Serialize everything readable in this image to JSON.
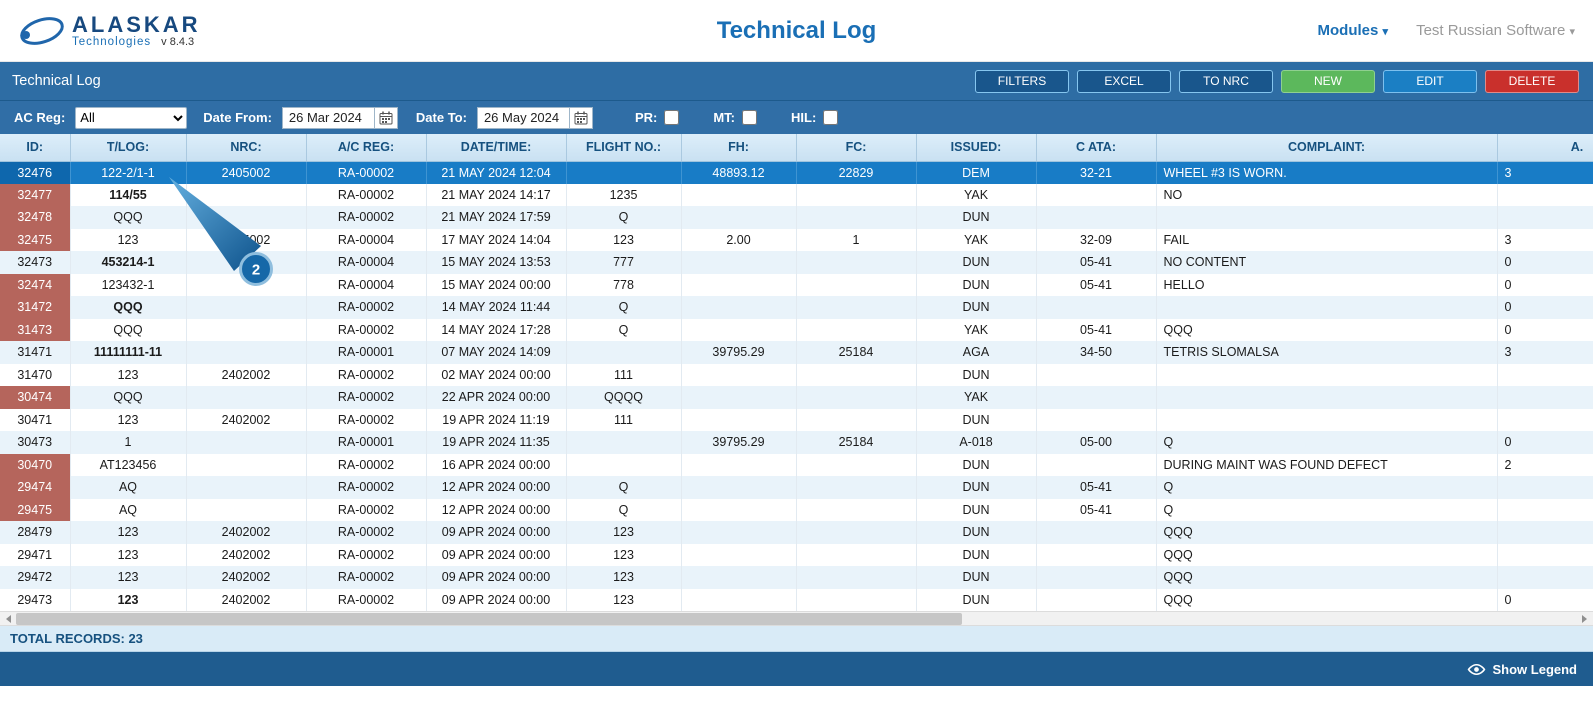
{
  "app": {
    "logo_brand": "ALASKAR",
    "logo_sub": "Technologies",
    "version": "v 8.4.3",
    "page_title": "Technical Log",
    "nav": {
      "modules": "Modules",
      "user": "Test Russian Software",
      "caret": "▾"
    }
  },
  "panel": {
    "title": "Technical Log",
    "buttons": {
      "filters": "FILTERS",
      "excel": "EXCEL",
      "to_nrc": "TO NRC",
      "new": "NEW",
      "edit": "EDIT",
      "delete": "DELETE"
    }
  },
  "filters": {
    "ac_reg_label": "AC Reg:",
    "ac_reg_value": "All",
    "date_from_label": "Date From:",
    "date_from_value": "26 Mar 2024",
    "date_to_label": "Date To:",
    "date_to_value": "26 May 2024",
    "pr_label": "PR:",
    "pr_checked": false,
    "mt_label": "MT:",
    "mt_checked": false,
    "hil_label": "HIL:",
    "hil_checked": false
  },
  "table": {
    "columns": [
      "ID:",
      "T/LOG:",
      "NRC:",
      "A/C REG:",
      "DATE/TIME:",
      "FLIGHT NO.:",
      "FH:",
      "FC:",
      "ISSUED:",
      "C ATA:",
      "COMPLAINT:",
      "A."
    ],
    "rows": [
      {
        "id": "32476",
        "selected": true,
        "tlog": "122-2/1-1",
        "nrc": "2405002",
        "acreg": "RA-00002",
        "datetime": "21 MAY 2024 12:04",
        "fh": "48893.12",
        "fc": "22829",
        "issued": "DEM",
        "cata": "32-21",
        "complaint": "WHEEL #3 IS WORN.",
        "a": "3"
      },
      {
        "id": "32477",
        "id_red": true,
        "tlog": "114/55",
        "tlog_bold": true,
        "acreg": "RA-00002",
        "datetime": "21 MAY 2024 14:17",
        "flight": "1235",
        "issued": "YAK",
        "complaint": "NO"
      },
      {
        "id": "32478",
        "id_red": true,
        "tlog": "QQQ",
        "acreg": "RA-00002",
        "datetime": "21 MAY 2024 17:59",
        "flight": "Q",
        "issued": "DUN"
      },
      {
        "id": "32475",
        "id_red": true,
        "tlog": "123",
        "nrc": "2405002",
        "acreg": "RA-00004",
        "datetime": "17 MAY 2024 14:04",
        "flight": "123",
        "fh": "2.00",
        "fc": "1",
        "issued": "YAK",
        "cata": "32-09",
        "complaint": "FAIL",
        "a": "3"
      },
      {
        "id": "32473",
        "tlog": "453214-1",
        "tlog_bold": true,
        "acreg": "RA-00004",
        "datetime": "15 MAY 2024 13:53",
        "flight": "777",
        "issued": "DUN",
        "cata": "05-41",
        "complaint": "NO CONTENT",
        "a": "0"
      },
      {
        "id": "32474",
        "id_red": true,
        "tlog": "123432-1",
        "acreg": "RA-00004",
        "datetime": "15 MAY 2024 00:00",
        "flight": "778",
        "issued": "DUN",
        "cata": "05-41",
        "complaint": "HELLO",
        "a": "0"
      },
      {
        "id": "31472",
        "id_red": true,
        "tlog": "QQQ",
        "tlog_bold": true,
        "acreg": "RA-00002",
        "datetime": "14 MAY 2024 11:44",
        "flight": "Q",
        "issued": "DUN",
        "a": "0"
      },
      {
        "id": "31473",
        "id_red": true,
        "tlog": "QQQ",
        "acreg": "RA-00002",
        "datetime": "14 MAY 2024 17:28",
        "flight": "Q",
        "issued": "YAK",
        "cata": "05-41",
        "complaint": "QQQ",
        "a": "0"
      },
      {
        "id": "31471",
        "tlog": "11111111-11",
        "tlog_bold": true,
        "acreg": "RA-00001",
        "datetime": "07 MAY 2024 14:09",
        "fh": "39795.29",
        "fc": "25184",
        "issued": "AGA",
        "cata": "34-50",
        "complaint": "TETRIS SLOMALSA",
        "a": "3"
      },
      {
        "id": "31470",
        "tlog": "123",
        "nrc": "2402002",
        "acreg": "RA-00002",
        "datetime": "02 MAY 2024 00:00",
        "flight": "111",
        "issued": "DUN"
      },
      {
        "id": "30474",
        "id_red": true,
        "tlog": "QQQ",
        "acreg": "RA-00002",
        "datetime": "22 APR 2024 00:00",
        "flight": "QQQQ",
        "issued": "YAK"
      },
      {
        "id": "30471",
        "tlog": "123",
        "nrc": "2402002",
        "acreg": "RA-00002",
        "datetime": "19 APR 2024 11:19",
        "flight": "111",
        "issued": "DUN"
      },
      {
        "id": "30473",
        "tlog": "1",
        "acreg": "RA-00001",
        "datetime": "19 APR 2024 11:35",
        "fh": "39795.29",
        "fc": "25184",
        "issued": "A-018",
        "cata": "05-00",
        "complaint": "Q",
        "a": "0"
      },
      {
        "id": "30470",
        "id_red": true,
        "tlog": "AT123456",
        "acreg": "RA-00002",
        "datetime": "16 APR 2024 00:00",
        "issued": "DUN",
        "complaint": "DURING MAINT WAS FOUND DEFECT",
        "a": "2"
      },
      {
        "id": "29474",
        "id_red": true,
        "tlog": "AQ",
        "acreg": "RA-00002",
        "datetime": "12 APR 2024 00:00",
        "flight": "Q",
        "issued": "DUN",
        "cata": "05-41",
        "complaint": "Q"
      },
      {
        "id": "29475",
        "id_red": true,
        "tlog": "AQ",
        "acreg": "RA-00002",
        "datetime": "12 APR 2024 00:00",
        "flight": "Q",
        "issued": "DUN",
        "cata": "05-41",
        "complaint": "Q"
      },
      {
        "id": "28479",
        "tlog": "123",
        "nrc": "2402002",
        "acreg": "RA-00002",
        "datetime": "09 APR 2024 00:00",
        "flight": "123",
        "issued": "DUN",
        "complaint": "QQQ"
      },
      {
        "id": "29471",
        "tlog": "123",
        "nrc": "2402002",
        "acreg": "RA-00002",
        "datetime": "09 APR 2024 00:00",
        "flight": "123",
        "issued": "DUN",
        "complaint": "QQQ"
      },
      {
        "id": "29472",
        "tlog": "123",
        "nrc": "2402002",
        "acreg": "RA-00002",
        "datetime": "09 APR 2024 00:00",
        "flight": "123",
        "issued": "DUN",
        "complaint": "QQQ"
      },
      {
        "id": "29473",
        "tlog": "123",
        "tlog_bold": true,
        "nrc": "2402002",
        "acreg": "RA-00002",
        "datetime": "09 APR 2024 00:00",
        "flight": "123",
        "issued": "DUN",
        "complaint": "QQQ",
        "a": "0"
      }
    ]
  },
  "footer": {
    "total_records": "TOTAL RECORDS: 23",
    "show_legend": "Show Legend"
  },
  "annotation": {
    "step_label": "2"
  },
  "colors": {
    "panel_blue": "#2e6da4",
    "filter_blue": "#306ea6",
    "title_blue": "#1a6fb5",
    "brand_navy": "#17497f",
    "header_text": "#16517f",
    "stripe": "#e9f3fa",
    "selected_row": "#187cc6",
    "red_id": "#b5655c",
    "btn_outline_bg": "#19568c",
    "btn_outline_border": "#86c6ef",
    "btn_green": "#5cb85c",
    "btn_blue": "#1b7fc4",
    "btn_red": "#c9302c",
    "footer_blue": "#1f5c8f",
    "total_bg": "#d9ebf7",
    "annotation_blue": "#1668a8"
  }
}
